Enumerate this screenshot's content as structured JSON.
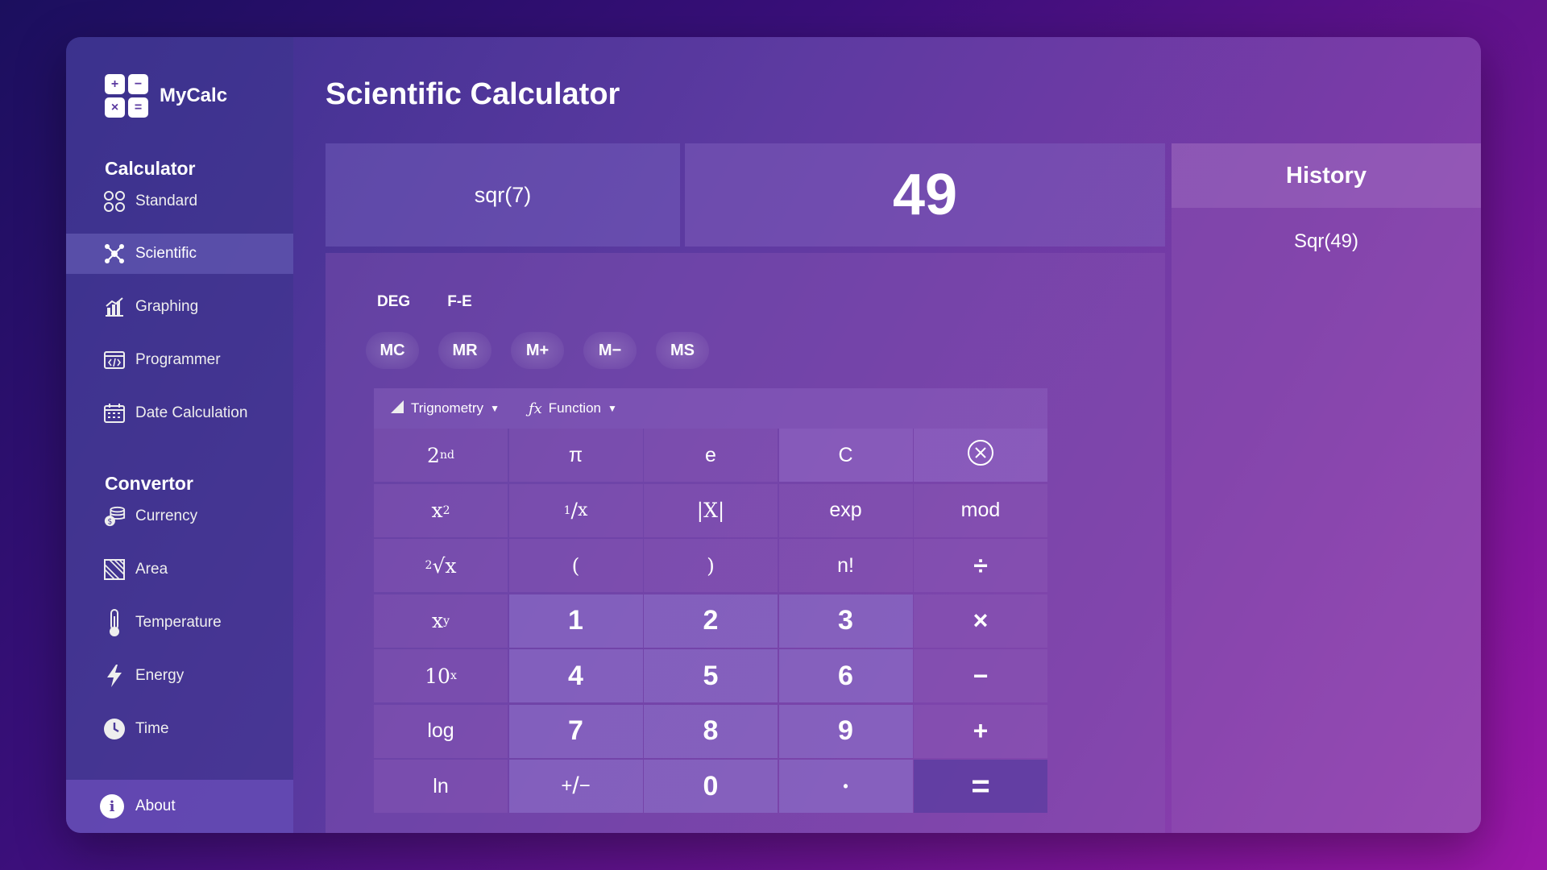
{
  "app": {
    "name": "MyCalc",
    "page_title": "Scientific Calculator"
  },
  "sidebar": {
    "calculator_title": "Calculator",
    "calculator_items": [
      {
        "label": "Standard",
        "icon": "standard-icon"
      },
      {
        "label": "Scientific",
        "icon": "scientific-icon",
        "active": true
      },
      {
        "label": "Graphing",
        "icon": "graphing-icon"
      },
      {
        "label": "Programmer",
        "icon": "programmer-icon"
      },
      {
        "label": "Date Calculation",
        "icon": "calendar-icon"
      }
    ],
    "convertor_title": "Convertor",
    "convertor_items": [
      {
        "label": "Currency",
        "icon": "currency-icon"
      },
      {
        "label": "Area",
        "icon": "area-icon"
      },
      {
        "label": "Temperature",
        "icon": "thermometer-icon"
      },
      {
        "label": "Energy",
        "icon": "lightning-icon"
      },
      {
        "label": "Time",
        "icon": "clock-icon"
      }
    ],
    "about_label": "About"
  },
  "display": {
    "expression": "sqr(7)",
    "result": "49"
  },
  "modes": {
    "angle": "DEG",
    "notation": "F-E"
  },
  "memory": [
    "MC",
    "MR",
    "M+",
    "M−",
    "MS"
  ],
  "toolbar": {
    "trig_label": "Trignometry",
    "func_label": "Function"
  },
  "keys": {
    "pi": "π",
    "e": "e",
    "clear": "C",
    "abs": "|X|",
    "exp": "exp",
    "mod": "mod",
    "lparen": "(",
    "rparen": ")",
    "fact": "n!",
    "div": "÷",
    "one": "1",
    "two": "2",
    "three": "3",
    "mul": "×",
    "four": "4",
    "five": "5",
    "six": "6",
    "minus": "−",
    "log": "log",
    "seven": "7",
    "eight": "8",
    "nine": "9",
    "plus": "+",
    "ln": "ln",
    "zero": "0",
    "dot": "•",
    "equals": "="
  },
  "history": {
    "title": "History",
    "items": [
      "Sqr(49)"
    ]
  }
}
